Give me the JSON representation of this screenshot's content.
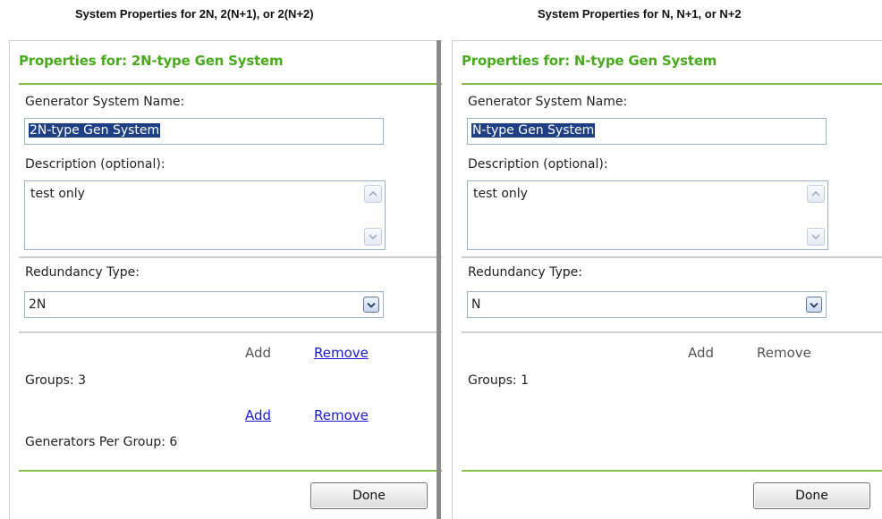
{
  "captions": {
    "left": "System Properties for 2N, 2(N+1), or 2(N+2)",
    "right": "System Properties for N, N+1, or N+2"
  },
  "panels": [
    {
      "title": "Properties for: 2N-type Gen System",
      "name_label": "Generator System Name:",
      "name_value": "2N-type Gen System",
      "description_label": "Description (optional):",
      "description_value": "test only",
      "redundancy_label": "Redundancy Type:",
      "redundancy_value": "2N",
      "groups_add": "Add",
      "groups_remove": "Remove",
      "groups_label": "Groups: 3",
      "generators_add": "Add",
      "generators_remove": "Remove",
      "generators_label": "Generators Per Group: 6",
      "done_label": "Done"
    },
    {
      "title": "Properties for: N-type Gen System",
      "name_label": "Generator System Name:",
      "name_value": "N-type Gen System",
      "description_label": "Description (optional):",
      "description_value": "test only",
      "redundancy_label": "Redundancy Type:",
      "redundancy_value": "N",
      "groups_add": "Add",
      "groups_remove": "Remove",
      "groups_label": "Groups: 1",
      "done_label": "Done"
    }
  ],
  "colors": {
    "title_green": "#4aaa1e",
    "rule_green": "#86c449",
    "link_blue": "#1a1ad0",
    "selection_bg": "#1f3f85"
  },
  "icons": {
    "scroll_up": "chevron-up-icon",
    "scroll_down": "chevron-down-icon",
    "dropdown": "chevron-down-icon"
  }
}
